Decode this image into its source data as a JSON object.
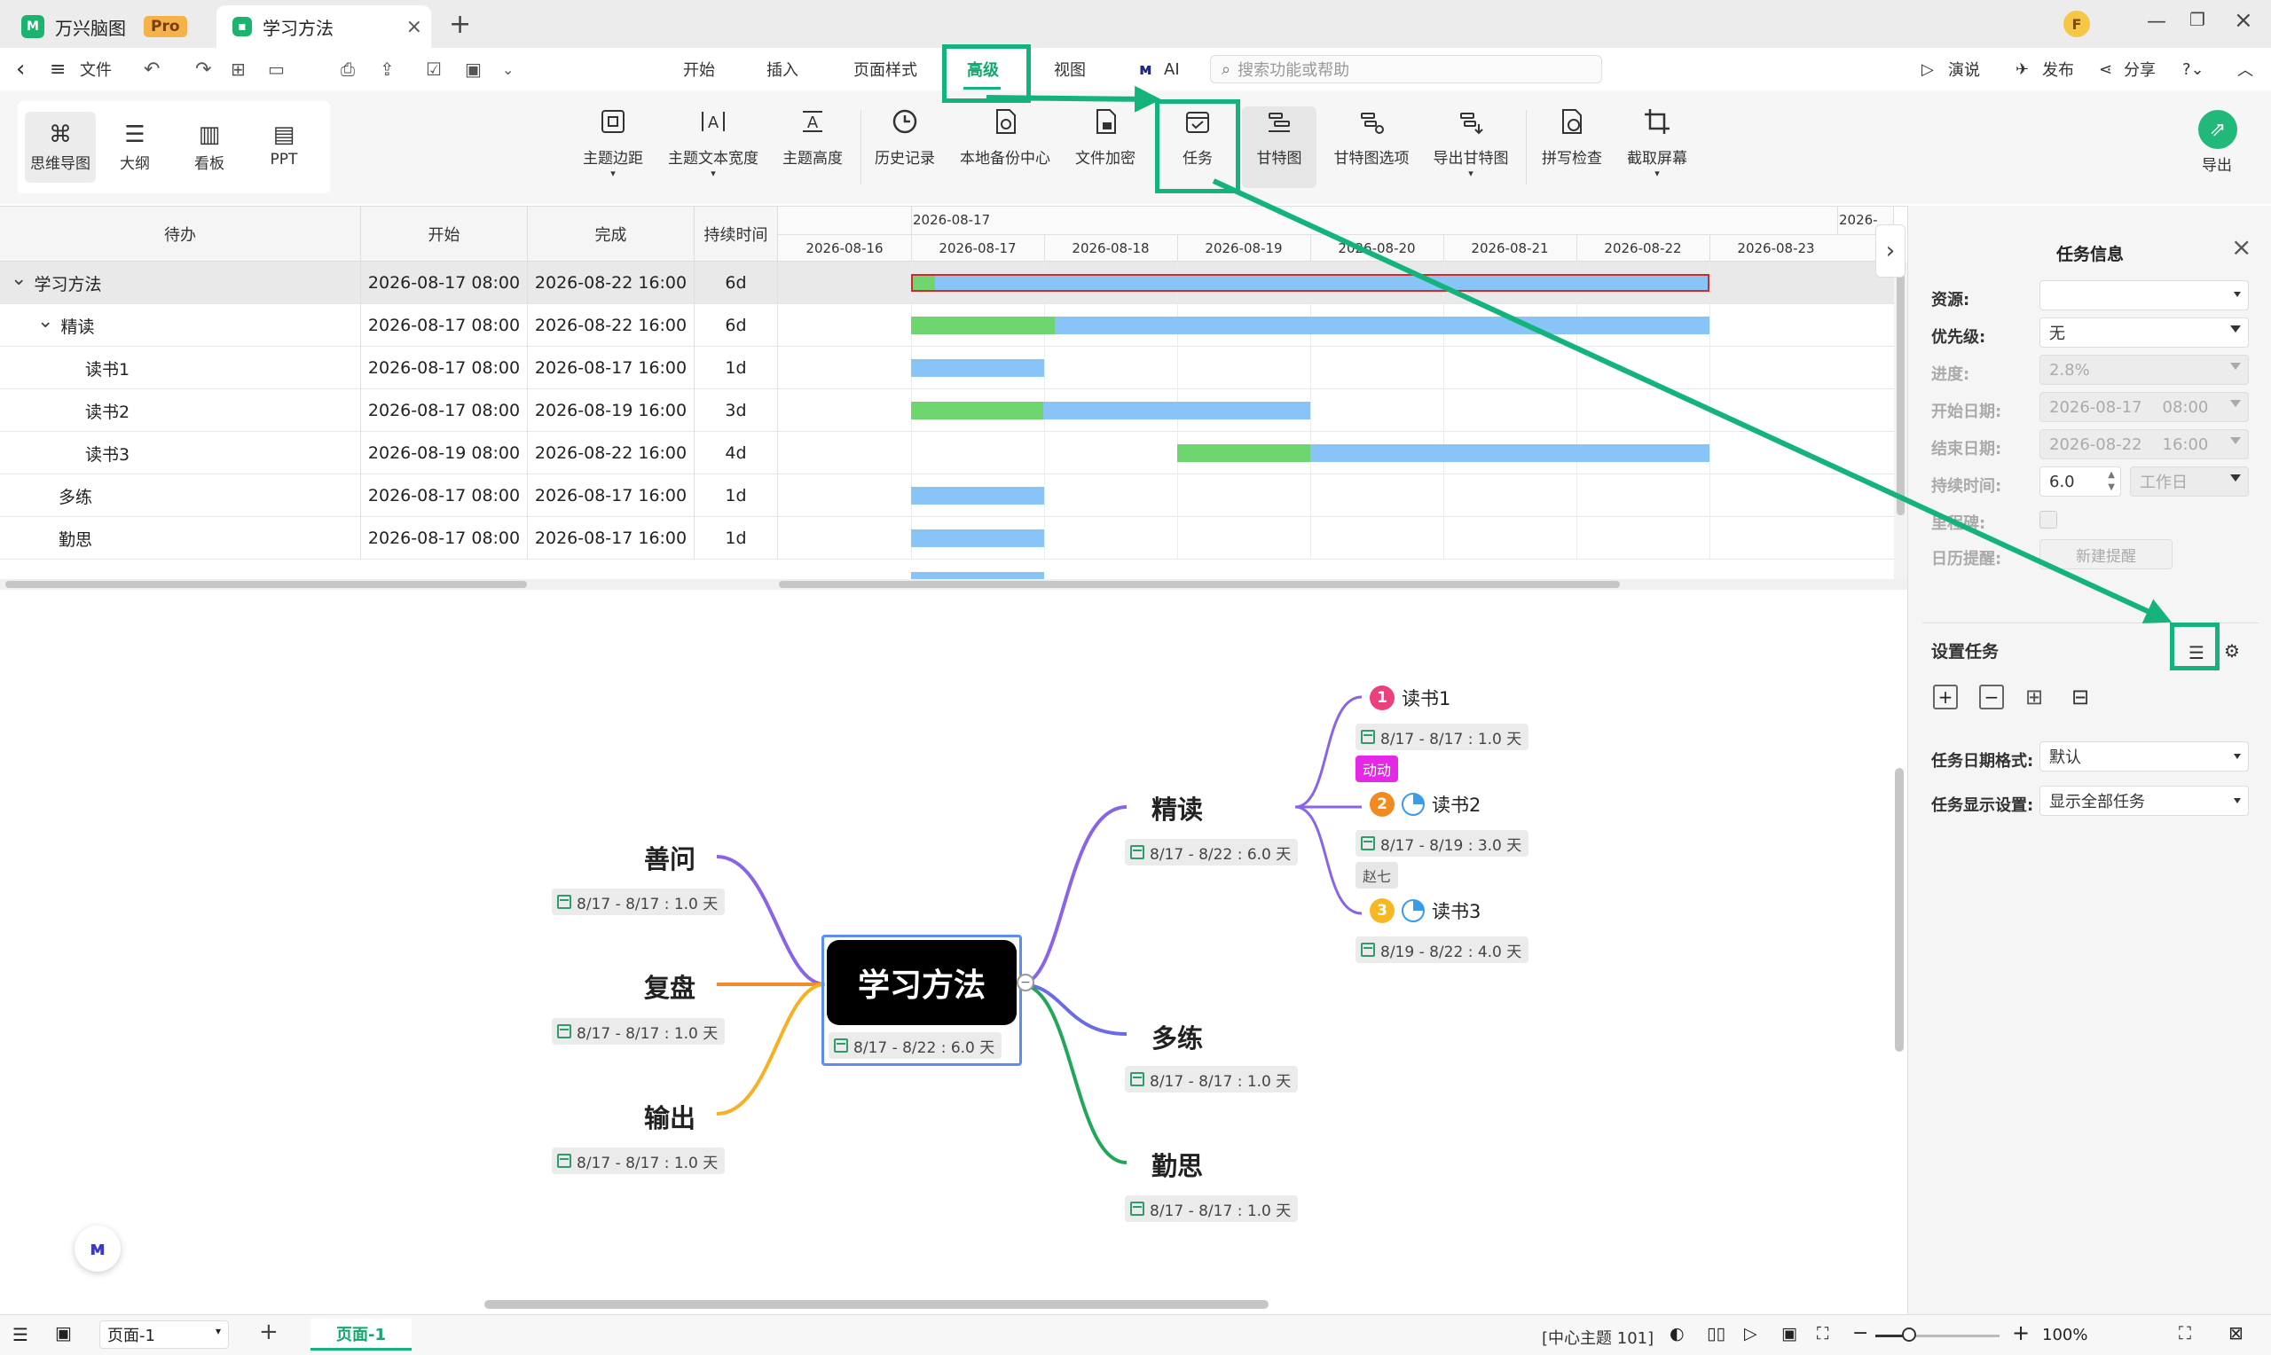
{
  "tabs": [
    {
      "label": "万兴脑图",
      "badge": "Pro"
    },
    {
      "label": "学习方法"
    }
  ],
  "menu": {
    "file": "文件",
    "items": [
      "开始",
      "插入",
      "页面样式",
      "高级",
      "视图",
      "AI"
    ],
    "search_placeholder": "搜索功能或帮助",
    "right": [
      "演说",
      "发布",
      "分享"
    ]
  },
  "views": [
    "思维导图",
    "大纲",
    "看板",
    "PPT"
  ],
  "ribbon": [
    "主题边距",
    "主题文本宽度",
    "主题高度",
    "历史记录",
    "本地备份中心",
    "文件加密",
    "任务",
    "甘特图",
    "甘特图选项",
    "导出甘特图",
    "拼写检查",
    "截取屏幕"
  ],
  "export_label": "导出",
  "gantt": {
    "headers": [
      "待办",
      "开始",
      "完成",
      "持续时间"
    ],
    "top_date": "2026-08-17",
    "top_date2": "2026-",
    "dates": [
      "2026-08-16",
      "2026-08-17",
      "2026-08-18",
      "2026-08-19",
      "2026-08-20",
      "2026-08-21",
      "2026-08-22",
      "2026-08-23"
    ],
    "rows": [
      {
        "name": "学习方法",
        "start": "2026-08-17 08:00",
        "end": "2026-08-22 16:00",
        "dur": "6d"
      },
      {
        "name": "精读",
        "start": "2026-08-17 08:00",
        "end": "2026-08-22 16:00",
        "dur": "6d"
      },
      {
        "name": "读书1",
        "start": "2026-08-17 08:00",
        "end": "2026-08-17 16:00",
        "dur": "1d"
      },
      {
        "name": "读书2",
        "start": "2026-08-17 08:00",
        "end": "2026-08-19 16:00",
        "dur": "3d"
      },
      {
        "name": "读书3",
        "start": "2026-08-19 08:00",
        "end": "2026-08-22 16:00",
        "dur": "4d"
      },
      {
        "name": "多练",
        "start": "2026-08-17 08:00",
        "end": "2026-08-17 16:00",
        "dur": "1d"
      },
      {
        "name": "勤思",
        "start": "2026-08-17 08:00",
        "end": "2026-08-17 16:00",
        "dur": "1d"
      }
    ]
  },
  "panel": {
    "title": "任务信息",
    "fields": [
      {
        "label": "资源:",
        "value": ""
      },
      {
        "label": "优先级:",
        "value": "无"
      },
      {
        "label": "进度:",
        "value": "2.8%"
      },
      {
        "label": "开始日期:",
        "value": "2026-08-17    08:00"
      },
      {
        "label": "结束日期:",
        "value": "2026-08-22    16:00"
      },
      {
        "label": "持续时间:",
        "value": "6.0"
      },
      {
        "label": "里程碑:",
        "value": ""
      },
      {
        "label": "日历提醒:",
        "value": "新建提醒"
      }
    ],
    "duration_unit": "工作日",
    "set_task": "设置任务",
    "date_format_label": "任务日期格式:",
    "date_format_value": "默认",
    "display_label": "任务显示设置:",
    "display_value": "显示全部任务"
  },
  "map": {
    "center": {
      "label": "学习方法",
      "date": "8/17 - 8/22 : 6.0 天"
    },
    "left": [
      {
        "label": "善问",
        "date": "8/17 - 8/17 : 1.0 天"
      },
      {
        "label": "复盘",
        "date": "8/17 - 8/17 : 1.0 天"
      },
      {
        "label": "输出",
        "date": "8/17 - 8/17 : 1.0 天"
      }
    ],
    "right": [
      {
        "label": "精读",
        "date": "8/17 - 8/22 : 6.0 天"
      },
      {
        "label": "多练",
        "date": "8/17 - 8/17 : 1.0 天"
      },
      {
        "label": "勤思",
        "date": "8/17 - 8/17 : 1.0 天"
      }
    ],
    "leaves": [
      {
        "num": "1",
        "label": "读书1",
        "date": "8/17 - 8/17 : 1.0 天",
        "tag": "动动"
      },
      {
        "num": "2",
        "label": "读书2",
        "date": "8/17 - 8/19 : 3.0 天",
        "tag": "赵七"
      },
      {
        "num": "3",
        "label": "读书3",
        "date": "8/19 - 8/22 : 4.0 天"
      }
    ]
  },
  "status": {
    "page_select": "页面-1",
    "page_tab": "页面-1",
    "center_info": "[中心主题 101]",
    "zoom": "100%"
  },
  "colors": {
    "accent": "#15b37c",
    "bar_blue": "#89c4f7",
    "bar_green": "#6fd56f",
    "purple": "#8a64e6",
    "orange": "#f28a2e",
    "yellow": "#f5b123",
    "green": "#22a75a",
    "blue_branch": "#6b6be8"
  }
}
